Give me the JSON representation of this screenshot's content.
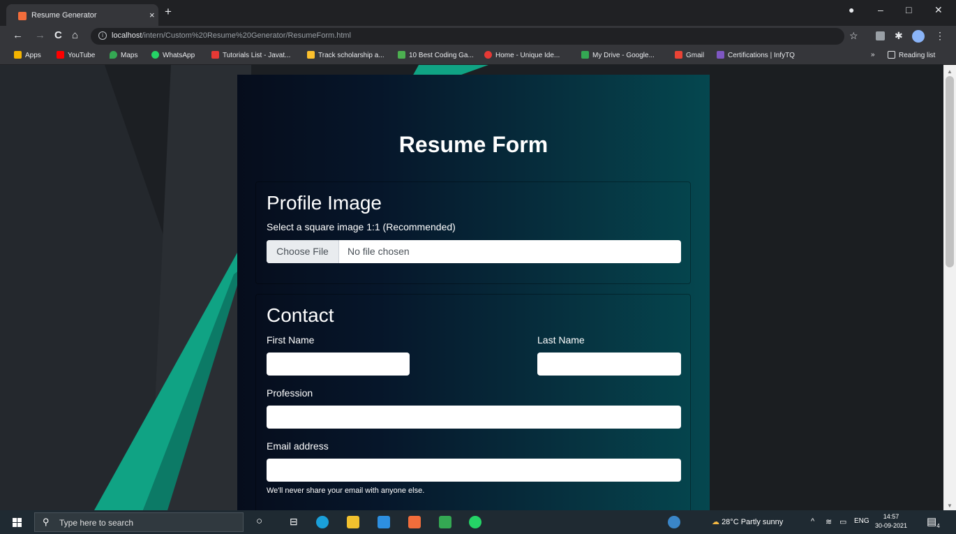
{
  "browser": {
    "tab_title": "Resume Generator",
    "tab_close": "×",
    "new_tab": "+",
    "url_host": "localhost",
    "url_path": "/intern/Custom%20Resume%20Generator/ResumeForm.html",
    "info_glyph": "i",
    "window_controls": {
      "minimize": "–",
      "maximize": "□",
      "close": "✕"
    },
    "nav": {
      "back": "←",
      "forward": "→",
      "reload": "C",
      "home": "⌂"
    },
    "star": "☆",
    "menu": "⋮",
    "puzzle": "✱"
  },
  "bookmarks": {
    "items": [
      {
        "label": "Apps",
        "color": "#f4b400"
      },
      {
        "label": "YouTube",
        "color": "#ff0000"
      },
      {
        "label": "Maps",
        "color": "#34a853"
      },
      {
        "label": "WhatsApp",
        "color": "#25d366"
      },
      {
        "label": "Tutorials List - Javat...",
        "color": "#e53935"
      },
      {
        "label": "Track scholarship a...",
        "color": "#fbc02d"
      },
      {
        "label": "10 Best Coding Ga...",
        "color": "#4caf50"
      },
      {
        "label": "Home - Unique Ide...",
        "color": "#e53935"
      },
      {
        "label": "My Drive - Google...",
        "color": "#34a853"
      },
      {
        "label": "Gmail",
        "color": "#ea4335"
      },
      {
        "label": "Certifications | InfyTQ",
        "color": "#7e57c2"
      }
    ],
    "overflow": "»",
    "reading_list": "Reading list"
  },
  "form": {
    "title": "Resume Form",
    "profile": {
      "heading": "Profile Image",
      "hint": "Select a square image 1:1 (Recommended)",
      "file_button": "Choose File",
      "file_status": "No file chosen"
    },
    "contact": {
      "heading": "Contact",
      "first_name_label": "First Name",
      "last_name_label": "Last Name",
      "profession_label": "Profession",
      "email_label": "Email address",
      "email_help": "We'll never share your email with anyone else.",
      "first_name_value": "",
      "last_name_value": "",
      "profession_value": "",
      "email_value": ""
    }
  },
  "taskbar": {
    "search_placeholder": "Type here to search",
    "weather": "28°C  Partly sunny",
    "language": "ENG",
    "time": "14:57",
    "date": "30-09-2021",
    "notifications": "4"
  },
  "colors": {
    "accent_teal": "#19a88a",
    "panel_dark": "#060d1c",
    "panel_teal": "#05474f"
  }
}
